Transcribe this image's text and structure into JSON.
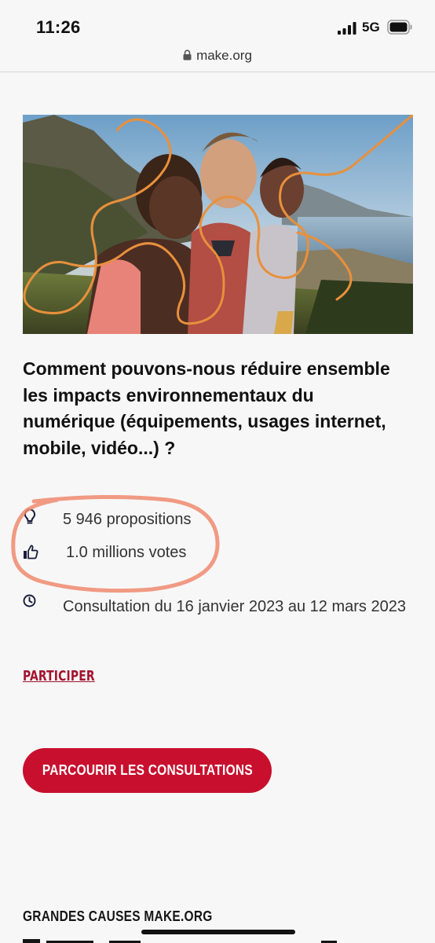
{
  "status_bar": {
    "time": "11:26",
    "network": "5G"
  },
  "browser": {
    "url": "make.org"
  },
  "consultation": {
    "title": "Comment pouvons-nous réduire ensemble les impacts environnementaux du numérique (équipements, usages internet, mobile, vidéo...) ?",
    "proposals": "5 946 propositions",
    "votes": "1.0 millions votes",
    "dates": "Consultation du 16 janvier 2023 au 12 mars 2023",
    "participate_label": "PARTICIPER"
  },
  "cta": {
    "browse_label": "PARCOURIR LES CONSULTATIONS"
  },
  "footer_section": {
    "title": "GRANDES CAUSES MAKE.ORG"
  },
  "icons": {
    "proposals": "lightbulb-icon",
    "votes": "thumbs-up-icon",
    "dates": "clock-icon"
  },
  "colors": {
    "accent": "#c8102e",
    "link": "#a3132e",
    "annotation": "#f08a6e",
    "hero_line": "#e8903c"
  }
}
